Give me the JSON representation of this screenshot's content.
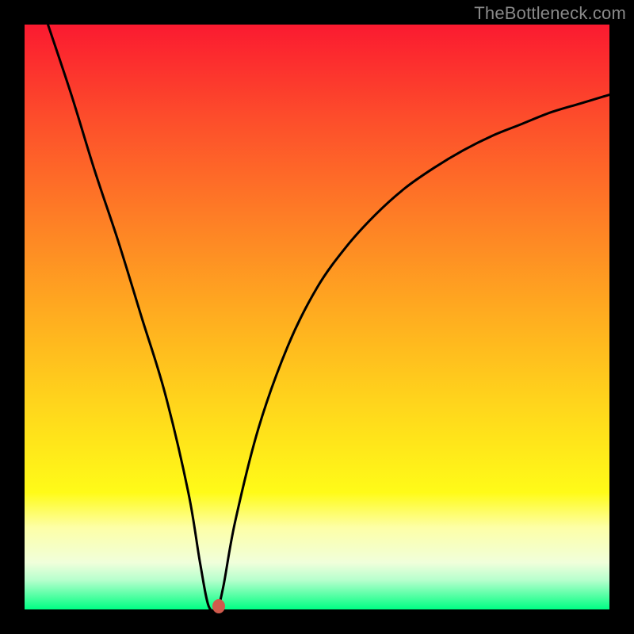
{
  "watermark": "TheBottleneck.com",
  "chart_data": {
    "type": "line",
    "title": "",
    "xlabel": "",
    "ylabel": "",
    "xlim": [
      0,
      100
    ],
    "ylim": [
      0,
      100
    ],
    "grid": false,
    "legend": false,
    "gradient_colors": {
      "top": "#fb1a30",
      "bottom": "#00ff85"
    },
    "series": [
      {
        "name": "bottleneck-curve",
        "x": [
          4,
          8,
          12,
          16,
          20,
          24,
          28,
          30,
          31.5,
          33,
          34,
          36,
          40,
          45,
          50,
          55,
          60,
          65,
          70,
          75,
          80,
          85,
          90,
          95,
          100
        ],
        "y": [
          100,
          88,
          75,
          63,
          50,
          37,
          20,
          8,
          0.5,
          0.5,
          4,
          15,
          31,
          45,
          55,
          62,
          67.5,
          72,
          75.5,
          78.5,
          81,
          83,
          85,
          86.5,
          88
        ]
      }
    ],
    "marker": {
      "x": 33.2,
      "y": 0.5,
      "color": "#cf5a4c"
    }
  }
}
